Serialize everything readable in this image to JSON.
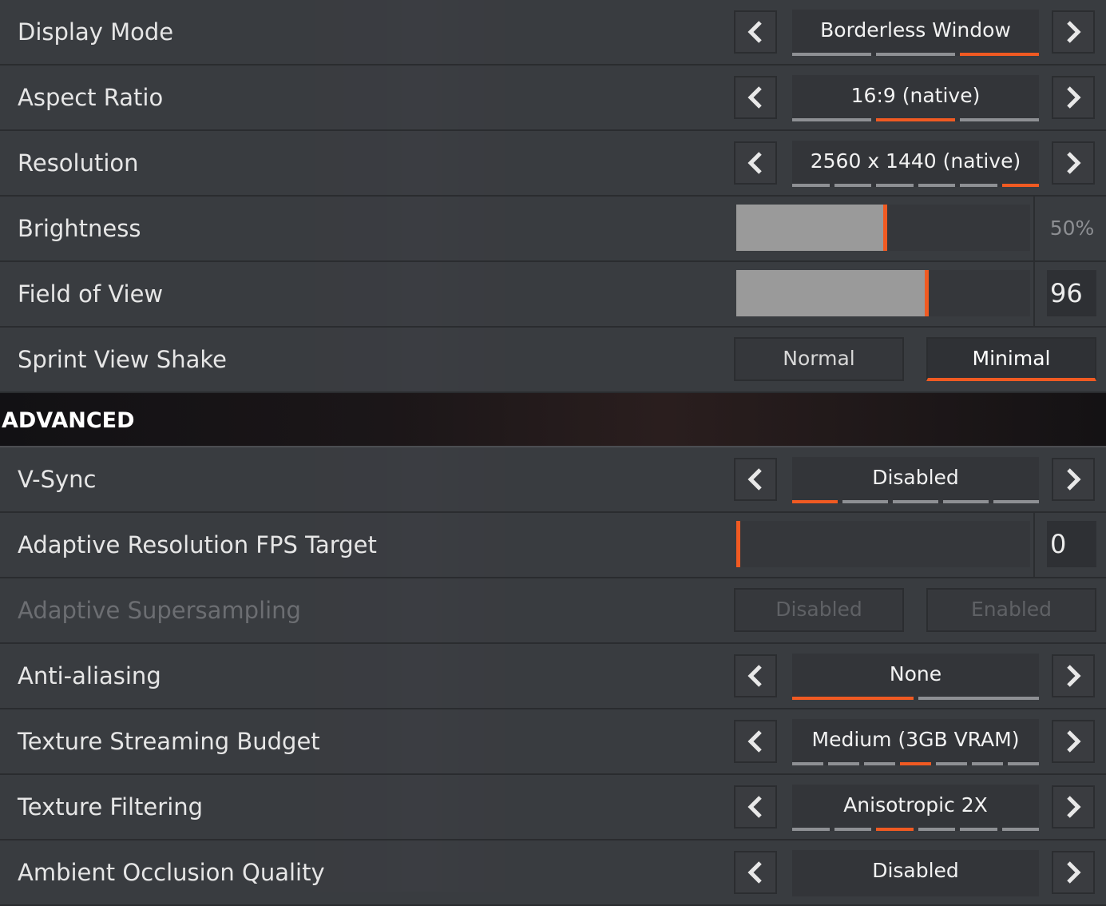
{
  "rows_top": {
    "display_mode": {
      "label": "Display Mode",
      "value": "Borderless Window",
      "options": 3,
      "selected": 2
    },
    "aspect_ratio": {
      "label": "Aspect Ratio",
      "value": "16:9 (native)",
      "options": 3,
      "selected": 1
    },
    "resolution": {
      "label": "Resolution",
      "value": "2560 x 1440 (native)",
      "options": 6,
      "selected": 5
    },
    "brightness": {
      "label": "Brightness",
      "value": "50%",
      "level": 0.5
    },
    "field_of_view": {
      "label": "Field of View",
      "value": "96",
      "level": 0.64
    },
    "sprint_view_shake": {
      "label": "Sprint View Shake",
      "option_normal": "Normal",
      "option_minimal": "Minimal",
      "selected": "Minimal"
    }
  },
  "section": {
    "advanced_title": "ADVANCED"
  },
  "rows_adv": {
    "vsync": {
      "label": "V-Sync",
      "value": "Disabled",
      "options": 5,
      "selected": 0
    },
    "adaptive_res": {
      "label": "Adaptive Resolution FPS Target",
      "value": "0",
      "level": 0
    },
    "adaptive_ss": {
      "label": "Adaptive Supersampling",
      "option_disabled": "Disabled",
      "option_enabled": "Enabled",
      "state": "unavailable"
    },
    "anti_aliasing": {
      "label": "Anti-aliasing",
      "value": "None",
      "options": 2,
      "selected": 0
    },
    "texture_budget": {
      "label": "Texture Streaming Budget",
      "value": "Medium (3GB VRAM)",
      "options": 7,
      "selected": 3
    },
    "texture_filtering": {
      "label": "Texture Filtering",
      "value": "Anisotropic 2X",
      "options": 6,
      "selected": 2
    },
    "ambient_occlusion": {
      "label": "Ambient Occlusion Quality",
      "value": "Disabled"
    }
  },
  "colors": {
    "accent": "#f05a22",
    "background": "#3b3e43"
  },
  "icons": {
    "left": "chevron-left-icon",
    "right": "chevron-right-icon"
  }
}
